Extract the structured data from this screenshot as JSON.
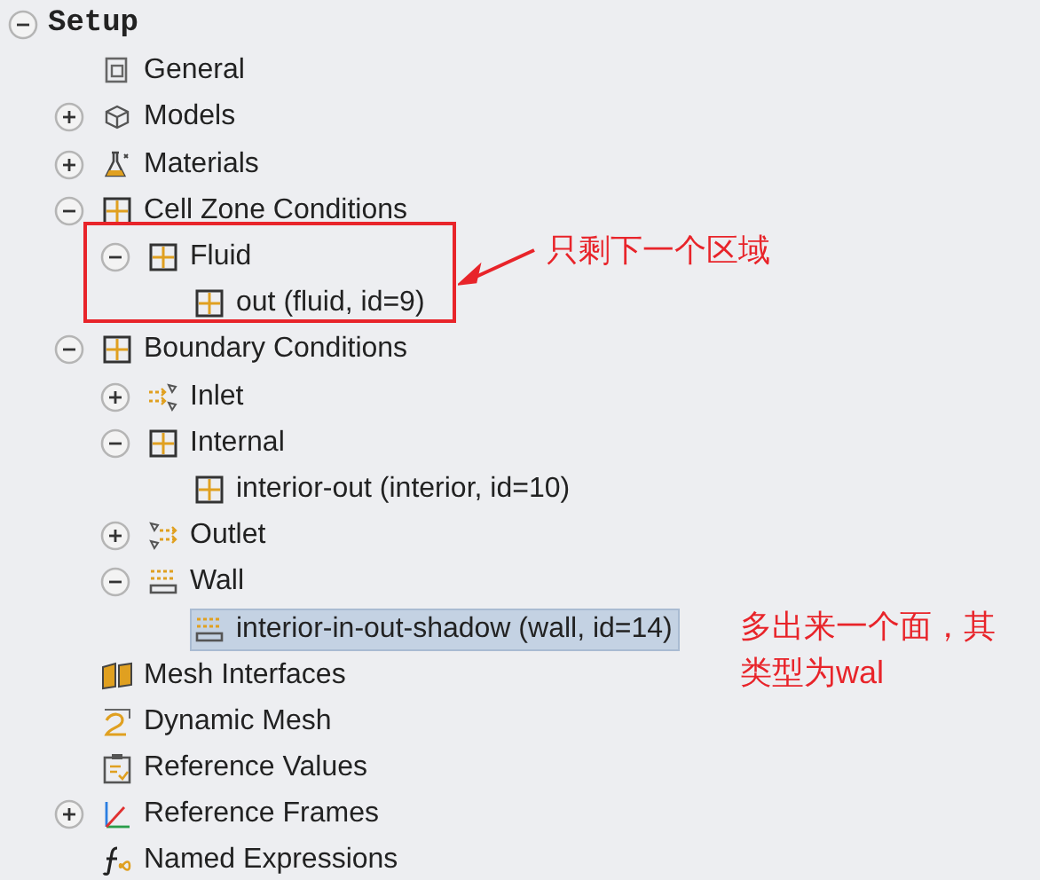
{
  "tree": [
    {
      "label": "Setup",
      "kind": "section",
      "expanded": true,
      "selected": false,
      "children": [
        {
          "label": "General",
          "kind": "general",
          "selected": false
        },
        {
          "label": "Models",
          "kind": "models",
          "expanded": false,
          "selected": false
        },
        {
          "label": "Materials",
          "kind": "materials",
          "expanded": false,
          "selected": false
        },
        {
          "label": "Cell Zone Conditions",
          "kind": "zone",
          "expanded": true,
          "selected": false,
          "children": [
            {
              "label": "Fluid",
              "kind": "zone",
              "expanded": true,
              "selected": false,
              "children": [
                {
                  "label": "out (fluid, id=9)",
                  "kind": "zone",
                  "selected": false
                }
              ]
            }
          ]
        },
        {
          "label": "Boundary Conditions",
          "kind": "zone",
          "expanded": true,
          "selected": false,
          "children": [
            {
              "label": "Inlet",
              "kind": "inlet",
              "expanded": false,
              "selected": false
            },
            {
              "label": "Internal",
              "kind": "zone",
              "expanded": true,
              "selected": false,
              "children": [
                {
                  "label": "interior-out (interior, id=10)",
                  "kind": "zone",
                  "selected": false
                }
              ]
            },
            {
              "label": "Outlet",
              "kind": "outlet",
              "expanded": false,
              "selected": false
            },
            {
              "label": "Wall",
              "kind": "wall",
              "expanded": true,
              "selected": false,
              "children": [
                {
                  "label": "interior-in-out-shadow (wall, id=14)",
                  "kind": "wall",
                  "selected": true
                }
              ]
            }
          ]
        },
        {
          "label": "Mesh Interfaces",
          "kind": "mesh-interfaces",
          "selected": false
        },
        {
          "label": "Dynamic Mesh",
          "kind": "dynamic-mesh",
          "selected": false
        },
        {
          "label": "Reference Values",
          "kind": "reference-values",
          "selected": false
        },
        {
          "label": "Reference Frames",
          "kind": "reference-frames",
          "expanded": false,
          "selected": false
        },
        {
          "label": "Named Expressions",
          "kind": "expressions",
          "selected": false
        }
      ]
    }
  ],
  "annotations": [
    {
      "text": "只剩下一个区域"
    },
    {
      "text": "多出来一个面，其类型为wal"
    }
  ]
}
